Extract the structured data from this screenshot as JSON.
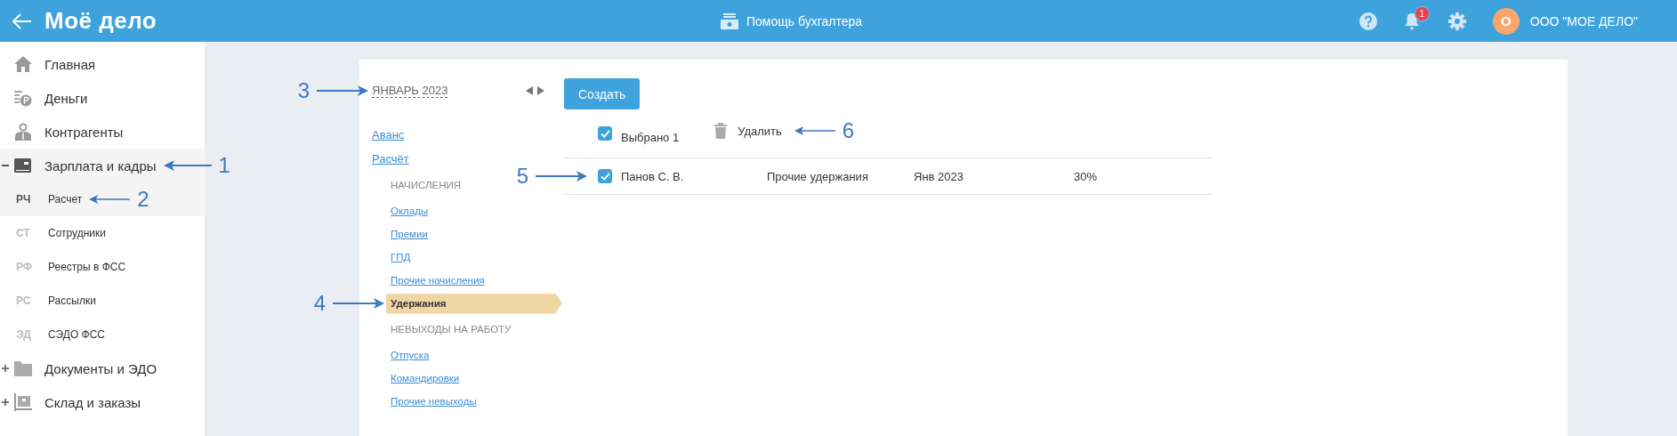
{
  "header": {
    "brand": "Моё дело",
    "title": "Помощь бухгалтера",
    "notifications": "1",
    "avatar": "О",
    "company": "ООО \"МОЕ ДЕЛО\""
  },
  "sidebar": {
    "items": [
      {
        "label": "Главная",
        "kind": "home"
      },
      {
        "label": "Деньги",
        "kind": "money"
      },
      {
        "label": "Контрагенты",
        "kind": "person"
      },
      {
        "label": "Зарплата и кадры",
        "kind": "wallet",
        "expanded": true,
        "annotation": "1",
        "children": [
          {
            "abbr": "РЧ",
            "label": "Расчет",
            "selected": true,
            "annotation": "2"
          },
          {
            "abbr": "СТ",
            "label": "Сотрудники",
            "selected": false
          },
          {
            "abbr": "РФ",
            "label": "Реестры в ФСС",
            "selected": false
          },
          {
            "abbr": "РС",
            "label": "Рассылки",
            "selected": false
          },
          {
            "abbr": "ЭД",
            "label": "СЭДО ФСС",
            "selected": false
          }
        ]
      },
      {
        "label": "Документы и ЭДО",
        "kind": "folder",
        "expanded": false
      },
      {
        "label": "Склад и заказы",
        "kind": "warehouse",
        "expanded": false
      }
    ]
  },
  "period": {
    "label": "ЯНВАРЬ 2023",
    "annotation": "3"
  },
  "nav": [
    {
      "kind": "link",
      "label": "Аванс",
      "selected": false
    },
    {
      "kind": "link",
      "label": "Расчёт",
      "selected": false,
      "children": [
        {
          "kind": "heading",
          "label": "НАЧИСЛЕНИЯ"
        },
        {
          "kind": "link",
          "label": "Оклады",
          "selected": false
        },
        {
          "kind": "link",
          "label": "Премии",
          "selected": false
        },
        {
          "kind": "link",
          "label": "ГПД",
          "selected": false
        },
        {
          "kind": "link",
          "label": "Прочие начисления",
          "selected": false
        },
        {
          "kind": "link",
          "label": "Удержания",
          "selected": true,
          "annotation": "4"
        },
        {
          "kind": "heading",
          "label": "НЕВЫХОДЫ НА РАБОТУ"
        },
        {
          "kind": "link",
          "label": "Отпуска",
          "selected": false
        },
        {
          "kind": "link",
          "label": "Командировки",
          "selected": false
        },
        {
          "kind": "link",
          "label": "Прочие невыходы",
          "selected": false
        }
      ]
    }
  ],
  "create_button": "Создать",
  "toolbar": {
    "select_all": {
      "label": "Выбрано 1",
      "checked": true
    },
    "delete": {
      "label": "Удалить",
      "annotation": "6"
    }
  },
  "rows": [
    {
      "checked": true,
      "annotation": "5",
      "cells": [
        "Панов С. В.",
        "Прочие удержания",
        "Янв 2023",
        "30%"
      ]
    }
  ]
}
